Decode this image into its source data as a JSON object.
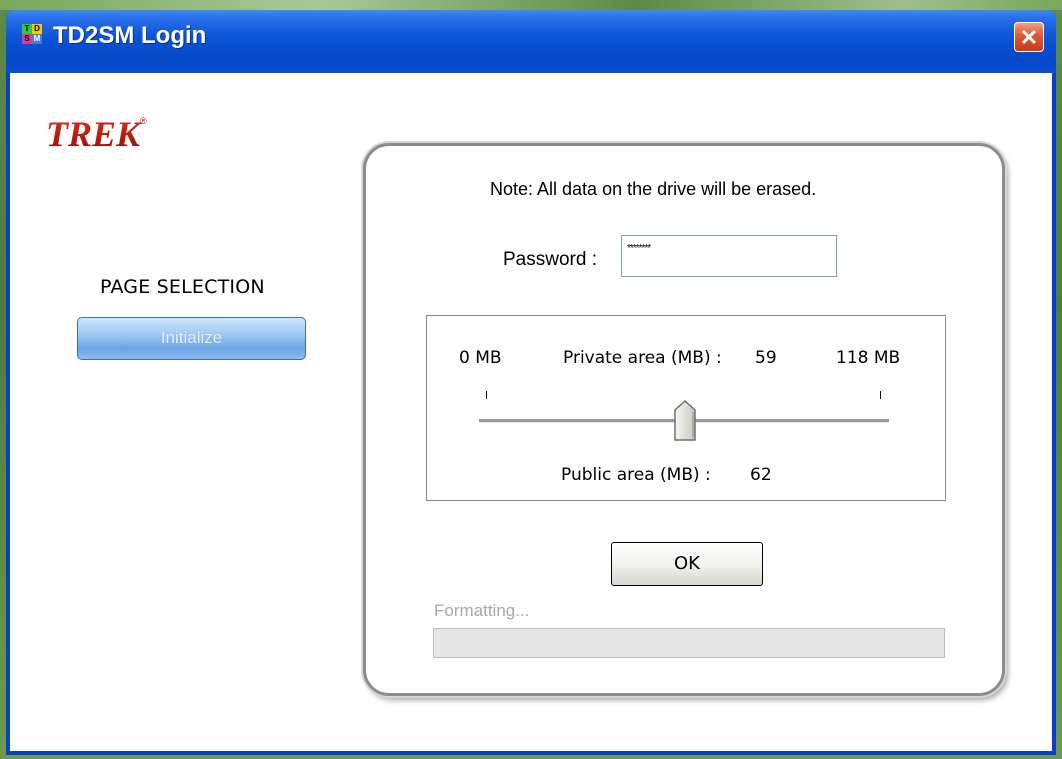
{
  "window": {
    "title": "TD2SM Login",
    "icon_letters": [
      "T",
      "D",
      "S",
      "M"
    ]
  },
  "logo": {
    "text": "TREK",
    "registered": "®"
  },
  "sidebar": {
    "heading": "PAGE SELECTION",
    "button_label": "Initialize"
  },
  "form": {
    "note": "Note: All data on the drive will be erased.",
    "password_label": "Password :",
    "password_value": "********"
  },
  "slider": {
    "min_label": "0 MB",
    "max_label": "118 MB",
    "private_label": "Private area (MB) :",
    "private_value": "59",
    "public_label": "Public area (MB) :",
    "public_value": "62",
    "position_fraction": 0.5
  },
  "ok_label": "OK",
  "progress": {
    "label": "Formatting...",
    "fraction": 0
  },
  "colors": {
    "titlebar": "#0548c8",
    "close_button": "#dd5a36",
    "accent_button": "#6aa4e6"
  }
}
